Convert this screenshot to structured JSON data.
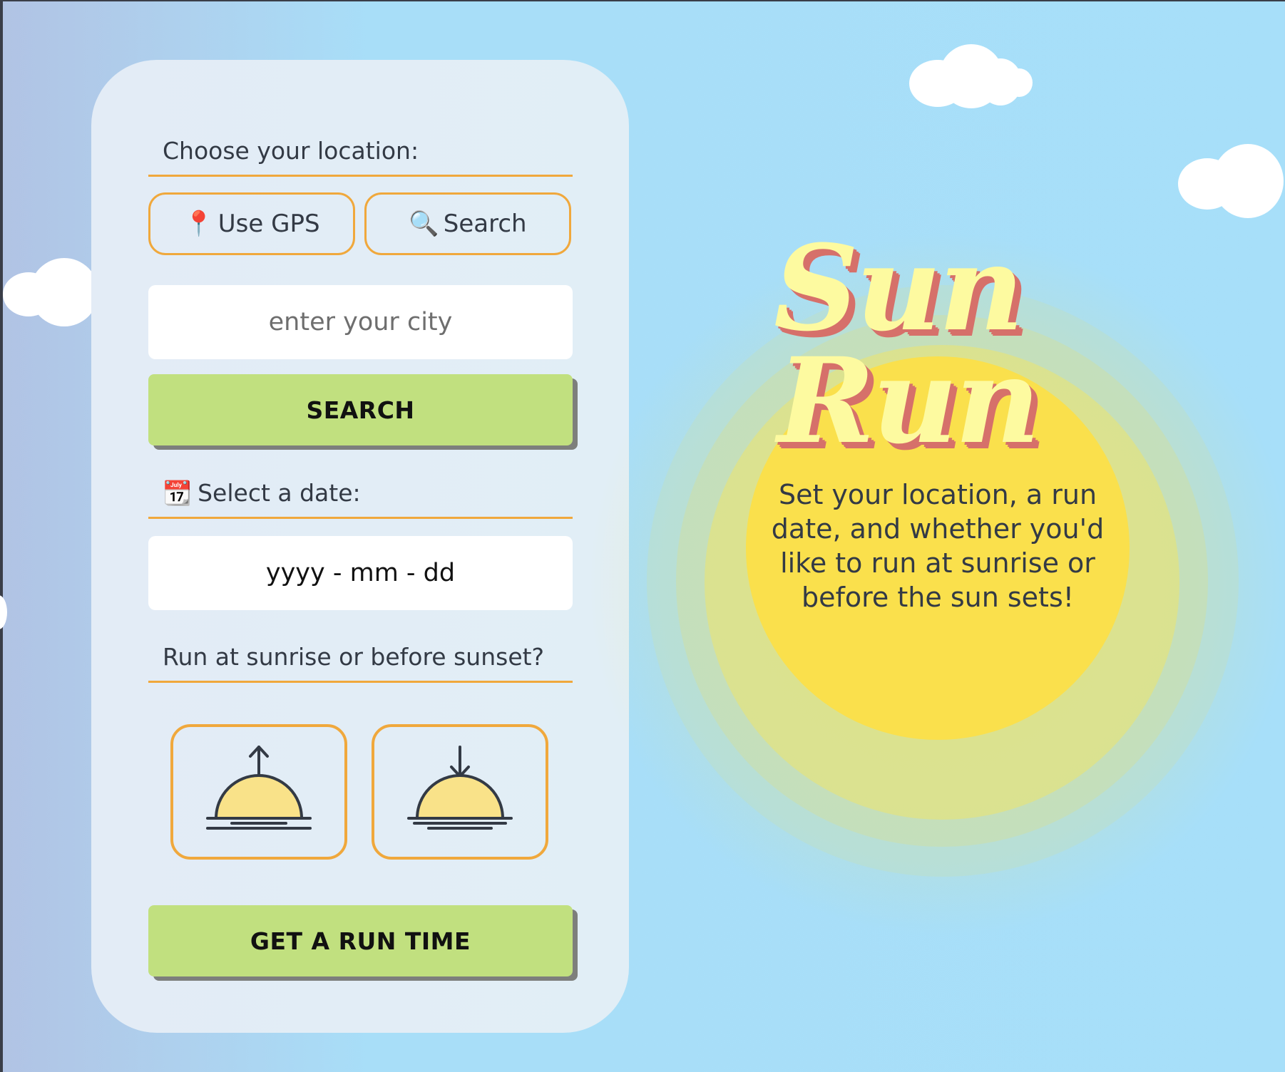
{
  "location": {
    "label": "Choose your location:",
    "gps_icon": "📍",
    "gps_label": "Use GPS",
    "search_icon": "🔍",
    "search_label": "Search",
    "city_placeholder": "enter your city",
    "search_button": "SEARCH"
  },
  "date": {
    "icon": "📆",
    "label": "Select a date:",
    "placeholder": "yyyy - mm - dd"
  },
  "timing": {
    "label": "Run at sunrise or before sunset?",
    "sunrise_icon": "sunrise-icon",
    "sunset_icon": "sunset-icon"
  },
  "submit_button": "GET A RUN TIME",
  "hero": {
    "title_line1": "Sun",
    "title_line2": "Run",
    "tagline": "Set your location, a run date, and whether you'd like to run at sunrise or before the sun sets!"
  },
  "colors": {
    "accent_orange": "#f0a83c",
    "button_green": "#c1e07f",
    "sun_yellow": "#fae04c",
    "sky_blue": "#a7dff9",
    "title_yellow": "#fdfaa0",
    "title_shadow": "#d6706a"
  }
}
